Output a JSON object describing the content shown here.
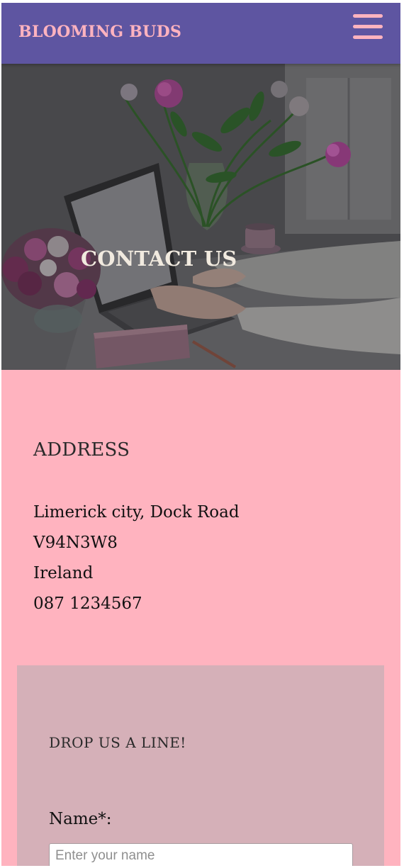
{
  "header": {
    "brand": "BLOOMING BUDS",
    "menu_icon": "hamburger-menu-icon",
    "brand_color": "#ffb3bf",
    "background_color": "#5e55a1"
  },
  "hero": {
    "title": "CONTACT US",
    "image_description_icon": "desk-laptop-flowers-photo"
  },
  "address": {
    "heading": "ADDRESS",
    "lines": [
      "Limerick city, Dock Road",
      "V94N3W8",
      "Ireland",
      "087 1234567"
    ],
    "background_color": "#ffb3bf"
  },
  "contact_form": {
    "heading": "DROP US A LINE!",
    "name_label": "Name*:",
    "name_placeholder": "Enter your name",
    "name_value": "",
    "panel_color": "#d5b0b8"
  }
}
